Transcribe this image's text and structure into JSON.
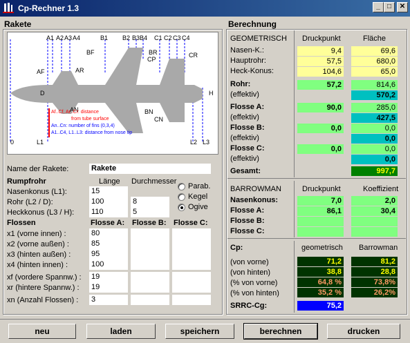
{
  "window": {
    "title": "Cp-Rechner 1.3",
    "min": "_",
    "max": "□",
    "close": "✕"
  },
  "rakete": {
    "title": "Rakete",
    "diagram": {
      "top_labels": [
        "A1",
        "A2",
        "A3",
        "A4",
        "B1",
        "B2",
        "B3",
        "B4",
        "C1",
        "C2",
        "C3",
        "C4"
      ],
      "side_labels": [
        "BF",
        "BR",
        "CP",
        "CR",
        "AF",
        "AR",
        "D",
        "H",
        "AN",
        "BN",
        "CN",
        "0",
        "L1",
        "L2",
        "L3"
      ],
      "legend": [
        "Af..Cf, Ar..Cr: distance",
        "from tube surface",
        "An..Cn: number of fins (0,3,4)",
        "A1..C4, L1..L3: distance from nose tip"
      ]
    },
    "name_label": "Name der Rakete:",
    "name_value": "Rakete",
    "rumpf": {
      "heading": "Rumpfrohr",
      "col_length": "Länge",
      "col_diameter": "Durchmesser",
      "rows": [
        {
          "label": "Nasenkonus (L1):",
          "length": "15",
          "diameter": ""
        },
        {
          "label": "Rohr (L2 / D):",
          "length": "100",
          "diameter": "8"
        },
        {
          "label": "Heckkonus (L3 / H):",
          "length": "110",
          "diameter": "5"
        }
      ],
      "nose_options": [
        "Parab.",
        "Kegel",
        "Ogive"
      ],
      "nose_selected": "Ogive"
    },
    "flossen": {
      "heading": "Flossen",
      "cols": [
        "Flosse A:",
        "Flosse B:",
        "Flosse C:"
      ],
      "rows": [
        {
          "label": "x1  (vorne innen) :",
          "a": "80",
          "b": "",
          "c": ""
        },
        {
          "label": "x2  (vorne außen) :",
          "a": "85",
          "b": "",
          "c": ""
        },
        {
          "label": "x3  (hinten außen) :",
          "a": "95",
          "b": "",
          "c": ""
        },
        {
          "label": "x4  (hinten innen) :",
          "a": "100",
          "b": "",
          "c": ""
        },
        {
          "label": "xf  (vordere Spannw.) :",
          "a": "19",
          "b": "",
          "c": ""
        },
        {
          "label": "xr  (hintere Spannw.) :",
          "a": "19",
          "b": "",
          "c": ""
        },
        {
          "label": "xn  (Anzahl Flossen) :",
          "a": "3",
          "b": "",
          "c": ""
        }
      ]
    }
  },
  "berechnung": {
    "title": "Berechnung",
    "geo": {
      "heading": "GEOMETRISCH",
      "col1": "Druckpunkt",
      "col2": "Fläche",
      "nasen_k": {
        "label": "Nasen-K.:",
        "dp": "9,4",
        "fl": "69,6"
      },
      "hauptrohr": {
        "label": "Hauptrohr:",
        "dp": "57,5",
        "fl": "680,0"
      },
      "heck": {
        "label": "Heck-Konus:",
        "dp": "104,6",
        "fl": "65,0"
      },
      "rohr": {
        "label": "Rohr:",
        "dp": "57,2",
        "fl": "814,6",
        "eff_label": "(effektiv)",
        "eff": "570,2"
      },
      "flosse_a": {
        "label": "Flosse A:",
        "dp": "90,0",
        "fl": "285,0",
        "eff_label": "(effektiv)",
        "eff": "427,5"
      },
      "flosse_b": {
        "label": "Flosse B:",
        "dp": "0,0",
        "fl": "0,0",
        "eff_label": "(effektiv)",
        "eff": "0,0"
      },
      "flosse_c": {
        "label": "Flosse C:",
        "dp": "0,0",
        "fl": "0,0",
        "eff_label": "(effektiv)",
        "eff": "0,0"
      },
      "gesamt": {
        "label": "Gesamt:",
        "value": "997,7"
      }
    },
    "barrowman": {
      "heading": "BARROWMAN",
      "col1": "Druckpunkt",
      "col2": "Koeffizient",
      "rows": [
        {
          "label": "Nasenkonus:",
          "dp": "7,0",
          "k": "2,0"
        },
        {
          "label": "Flosse A:",
          "dp": "86,1",
          "k": "30,4"
        },
        {
          "label": "Flosse B:",
          "dp": "",
          "k": ""
        },
        {
          "label": "Flosse C:",
          "dp": "",
          "k": ""
        }
      ]
    },
    "cp": {
      "heading": "Cp:",
      "col1": "geometrisch",
      "col2": "Barrowman",
      "rows": [
        {
          "label": "(von vorne)",
          "geo": "71,2",
          "bar": "81,2"
        },
        {
          "label": "(von hinten)",
          "geo": "38,8",
          "bar": "28,8"
        },
        {
          "label": "(% von vorne)",
          "geo": "64,8 %",
          "bar": "73,8%"
        },
        {
          "label": "(% von hinten)",
          "geo": "35,2 %",
          "bar": "26,2%"
        }
      ],
      "srrc_label": "SRRC-Cg:",
      "srrc_value": "75,2"
    }
  },
  "buttons": {
    "neu": "neu",
    "laden": "laden",
    "speichern": "speichern",
    "berechnen": "berechnen",
    "drucken": "drucken"
  },
  "colors": {
    "titlebar": "#0a246a",
    "dialog": "#d4d0c8",
    "rocket_body": "#a9a9a9",
    "legend_red": "#ff0000",
    "legend_blue": "#0000ff"
  }
}
